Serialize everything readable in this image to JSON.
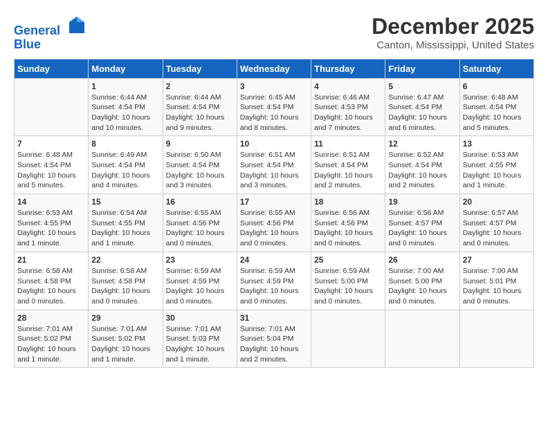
{
  "header": {
    "logo_line1": "General",
    "logo_line2": "Blue",
    "title": "December 2025",
    "subtitle": "Canton, Mississippi, United States"
  },
  "weekdays": [
    "Sunday",
    "Monday",
    "Tuesday",
    "Wednesday",
    "Thursday",
    "Friday",
    "Saturday"
  ],
  "weeks": [
    [
      {
        "day": "",
        "info": ""
      },
      {
        "day": "1",
        "info": "Sunrise: 6:44 AM\nSunset: 4:54 PM\nDaylight: 10 hours\nand 10 minutes."
      },
      {
        "day": "2",
        "info": "Sunrise: 6:44 AM\nSunset: 4:54 PM\nDaylight: 10 hours\nand 9 minutes."
      },
      {
        "day": "3",
        "info": "Sunrise: 6:45 AM\nSunset: 4:54 PM\nDaylight: 10 hours\nand 8 minutes."
      },
      {
        "day": "4",
        "info": "Sunrise: 6:46 AM\nSunset: 4:53 PM\nDaylight: 10 hours\nand 7 minutes."
      },
      {
        "day": "5",
        "info": "Sunrise: 6:47 AM\nSunset: 4:54 PM\nDaylight: 10 hours\nand 6 minutes."
      },
      {
        "day": "6",
        "info": "Sunrise: 6:48 AM\nSunset: 4:54 PM\nDaylight: 10 hours\nand 5 minutes."
      }
    ],
    [
      {
        "day": "7",
        "info": "Sunrise: 6:48 AM\nSunset: 4:54 PM\nDaylight: 10 hours\nand 5 minutes."
      },
      {
        "day": "8",
        "info": "Sunrise: 6:49 AM\nSunset: 4:54 PM\nDaylight: 10 hours\nand 4 minutes."
      },
      {
        "day": "9",
        "info": "Sunrise: 6:50 AM\nSunset: 4:54 PM\nDaylight: 10 hours\nand 3 minutes."
      },
      {
        "day": "10",
        "info": "Sunrise: 6:51 AM\nSunset: 4:54 PM\nDaylight: 10 hours\nand 3 minutes."
      },
      {
        "day": "11",
        "info": "Sunrise: 6:51 AM\nSunset: 4:54 PM\nDaylight: 10 hours\nand 2 minutes."
      },
      {
        "day": "12",
        "info": "Sunrise: 6:52 AM\nSunset: 4:54 PM\nDaylight: 10 hours\nand 2 minutes."
      },
      {
        "day": "13",
        "info": "Sunrise: 6:53 AM\nSunset: 4:55 PM\nDaylight: 10 hours\nand 1 minute."
      }
    ],
    [
      {
        "day": "14",
        "info": "Sunrise: 6:53 AM\nSunset: 4:55 PM\nDaylight: 10 hours\nand 1 minute."
      },
      {
        "day": "15",
        "info": "Sunrise: 6:54 AM\nSunset: 4:55 PM\nDaylight: 10 hours\nand 1 minute."
      },
      {
        "day": "16",
        "info": "Sunrise: 6:55 AM\nSunset: 4:56 PM\nDaylight: 10 hours\nand 0 minutes."
      },
      {
        "day": "17",
        "info": "Sunrise: 6:55 AM\nSunset: 4:56 PM\nDaylight: 10 hours\nand 0 minutes."
      },
      {
        "day": "18",
        "info": "Sunrise: 6:56 AM\nSunset: 4:56 PM\nDaylight: 10 hours\nand 0 minutes."
      },
      {
        "day": "19",
        "info": "Sunrise: 6:56 AM\nSunset: 4:57 PM\nDaylight: 10 hours\nand 0 minutes."
      },
      {
        "day": "20",
        "info": "Sunrise: 6:57 AM\nSunset: 4:57 PM\nDaylight: 10 hours\nand 0 minutes."
      }
    ],
    [
      {
        "day": "21",
        "info": "Sunrise: 6:58 AM\nSunset: 4:58 PM\nDaylight: 10 hours\nand 0 minutes."
      },
      {
        "day": "22",
        "info": "Sunrise: 6:58 AM\nSunset: 4:58 PM\nDaylight: 10 hours\nand 0 minutes."
      },
      {
        "day": "23",
        "info": "Sunrise: 6:59 AM\nSunset: 4:59 PM\nDaylight: 10 hours\nand 0 minutes."
      },
      {
        "day": "24",
        "info": "Sunrise: 6:59 AM\nSunset: 4:59 PM\nDaylight: 10 hours\nand 0 minutes."
      },
      {
        "day": "25",
        "info": "Sunrise: 6:59 AM\nSunset: 5:00 PM\nDaylight: 10 hours\nand 0 minutes."
      },
      {
        "day": "26",
        "info": "Sunrise: 7:00 AM\nSunset: 5:00 PM\nDaylight: 10 hours\nand 0 minutes."
      },
      {
        "day": "27",
        "info": "Sunrise: 7:00 AM\nSunset: 5:01 PM\nDaylight: 10 hours\nand 0 minutes."
      }
    ],
    [
      {
        "day": "28",
        "info": "Sunrise: 7:01 AM\nSunset: 5:02 PM\nDaylight: 10 hours\nand 1 minute."
      },
      {
        "day": "29",
        "info": "Sunrise: 7:01 AM\nSunset: 5:02 PM\nDaylight: 10 hours\nand 1 minute."
      },
      {
        "day": "30",
        "info": "Sunrise: 7:01 AM\nSunset: 5:03 PM\nDaylight: 10 hours\nand 1 minute."
      },
      {
        "day": "31",
        "info": "Sunrise: 7:01 AM\nSunset: 5:04 PM\nDaylight: 10 hours\nand 2 minutes."
      },
      {
        "day": "",
        "info": ""
      },
      {
        "day": "",
        "info": ""
      },
      {
        "day": "",
        "info": ""
      }
    ]
  ]
}
